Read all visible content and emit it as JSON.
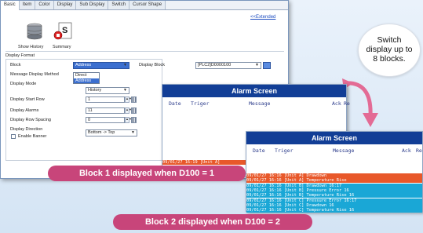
{
  "dialog": {
    "tabs": [
      "Basic",
      "Item",
      "Color",
      "Display",
      "Sub Display",
      "Switch",
      "Cursor Shape"
    ],
    "extended_link": "<<Extended",
    "show_history_label": "Show History",
    "summary_label": "Summary",
    "section_label": "Display Format",
    "block_label": "Block",
    "block_value": "Address",
    "block_options": [
      "Direct",
      "Address"
    ],
    "display_block_label": "Display Block",
    "display_block_value": "[PLC2]D0000100",
    "message_method_label": "Message Display Method",
    "display_mode_label": "Display Mode",
    "display_mode_value": "History",
    "start_row_label": "Display Start Row",
    "start_row_value": "1",
    "alarms_label": "Display Alarms",
    "alarms_value": "11",
    "row_spacing_label": "Display Row Spacing",
    "row_spacing_value": "0",
    "direction_label": "Display Direction",
    "direction_value": "Bottom -> Top",
    "banner_label": "Enable Banner"
  },
  "bubble": {
    "text_line1": "Switch",
    "text_line2": "display up to",
    "text_line3": "8 blocks."
  },
  "screen1": {
    "title": "Alarm Screen",
    "col_date": "Date",
    "col_trigger": "Triger",
    "col_message": "Message",
    "col_ack": "Ack",
    "col_re": "Re",
    "last_row": "09/01/27  16:19  [Unit A]"
  },
  "screen2": {
    "title": "Alarm Screen",
    "col_date": "Date",
    "col_trigger": "Triger",
    "col_message": "Message",
    "col_ack": "Ack",
    "col_re": "Re",
    "rows": [
      {
        "text": "09/01/27  16:16  [Unit A] Drawdown",
        "bg": "#e8582a"
      },
      {
        "text": "09/01/27  16:16  [Unit A] Temperature Rise",
        "bg": "#e8582a"
      },
      {
        "text": "09/01/27  16:16  [Unit B] Drawdown             16:17",
        "bg": "#1aa7d6"
      },
      {
        "text": "09/01/27  16:16  [Unit B] Pressure Error           16",
        "bg": "#1aa7d6"
      },
      {
        "text": "09/01/27  16:16  [Unit B] Temperature Rise         16",
        "bg": "#1aa7d6"
      },
      {
        "text": "09/01/27  16:16  [Unit C] Pressure Error  16:17",
        "bg": "#1aa7d6"
      },
      {
        "text": "09/01/27  16:16  [Unit C] Drawdown                 16",
        "bg": "#1aa7d6"
      },
      {
        "text": "09/01/27  16:16  [Unit C] Temperature Rise         16",
        "bg": "#1aa7d6"
      }
    ]
  },
  "captions": {
    "block1": "Block 1 displayed when D100 = 1",
    "block2": "Block 2 displayed when D100 = 2"
  },
  "colors": {
    "title_bar": "#123e96",
    "caption": "#c8457a",
    "arrow": "#e36b95"
  }
}
